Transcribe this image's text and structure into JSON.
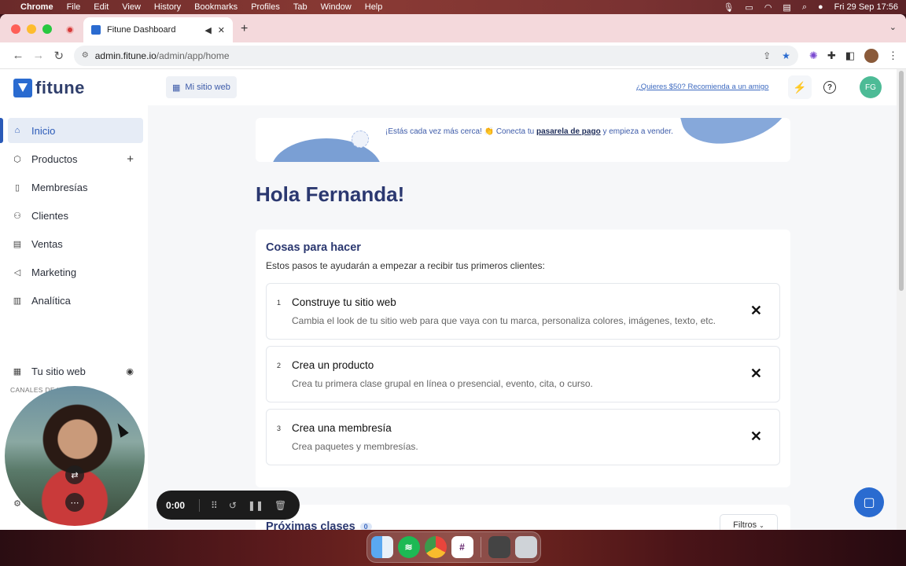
{
  "menubar": {
    "app": "Chrome",
    "items": [
      "File",
      "Edit",
      "View",
      "History",
      "Bookmarks",
      "Profiles",
      "Tab",
      "Window",
      "Help"
    ],
    "datetime": "Fri 29 Sep  17:56"
  },
  "browser": {
    "tab_title": "Fitune Dashboard",
    "url_host": "admin.fitune.io",
    "url_path": "/admin/app/home"
  },
  "header": {
    "logo_text": "fitune",
    "site_button": "Mi sitio web",
    "referral_link": "¿Quieres $50? Recomienda a un amigo",
    "avatar_initials": "FG"
  },
  "sidebar": {
    "items": [
      {
        "label": "Inicio",
        "icon": "home-icon"
      },
      {
        "label": "Productos",
        "icon": "box-icon"
      },
      {
        "label": "Membresías",
        "icon": "card-icon"
      },
      {
        "label": "Clientes",
        "icon": "users-icon"
      },
      {
        "label": "Ventas",
        "icon": "receipt-icon"
      },
      {
        "label": "Marketing",
        "icon": "megaphone-icon"
      },
      {
        "label": "Analítica",
        "icon": "chart-icon"
      }
    ],
    "section_label": "CANALES DE VENTAS",
    "channel": "Tu sitio web",
    "partial_bottom": "Co"
  },
  "banner": {
    "text_before": "¡Estás cada vez más cerca! 👏 Conecta tu ",
    "link": "pasarela de pago",
    "text_after": " y empieza a vender."
  },
  "greeting": "Hola Fernanda!",
  "todo": {
    "title": "Cosas para hacer",
    "subtitle": "Estos pasos te ayudarán a empezar a recibir tus primeros clientes:",
    "steps": [
      {
        "num": "1",
        "title": "Construye tu sitio web",
        "desc": "Cambia el look de tu sitio web para que vaya con tu marca, personaliza colores, imágenes, texto, etc."
      },
      {
        "num": "2",
        "title": "Crea un producto",
        "desc": "Crea tu primera clase grupal en línea o presencial, evento, cita, o curso."
      },
      {
        "num": "3",
        "title": "Crea una membresía",
        "desc": "Crea paquetes y membresías."
      }
    ]
  },
  "next_classes": {
    "title": "Próximas clases",
    "badge": "0",
    "filters": "Filtros"
  },
  "recorder": {
    "time": "0:00"
  }
}
